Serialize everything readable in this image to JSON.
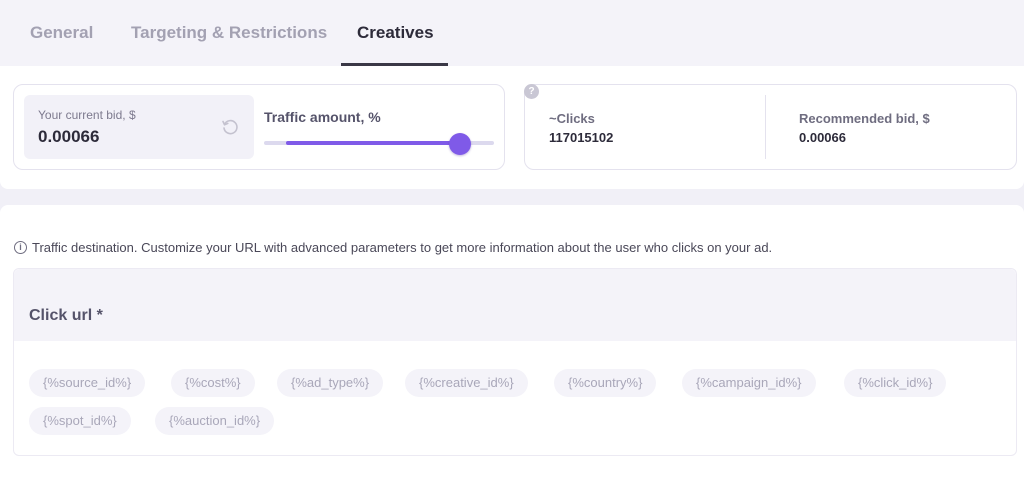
{
  "tabs": [
    {
      "label": "General"
    },
    {
      "label": "Targeting & Restrictions"
    },
    {
      "label": "Creatives"
    }
  ],
  "active_tab": "Creatives",
  "bid": {
    "label": "Your current bid, $",
    "value": "0.00066"
  },
  "traffic": {
    "label": "Traffic amount, %",
    "level_percent": 85
  },
  "stats": {
    "clicks_label": "~Clicks",
    "clicks_value": "117015102",
    "recommended_label": "Recommended bid, $",
    "recommended_value": "0.00066",
    "help_glyph": "?"
  },
  "destination": {
    "info_text": "Traffic destination. Customize your URL with advanced parameters to get more information about the user who clicks on your ad.",
    "info_glyph": "i",
    "click_url_placeholder": "Click url *",
    "params": [
      "{%source_id%}",
      "{%cost%}",
      "{%ad_type%}",
      "{%creative_id%}",
      "{%country%}",
      "{%campaign_id%}",
      "{%click_id%}",
      "{%spot_id%}",
      "{%auction_id%}"
    ]
  },
  "colors": {
    "accent": "#7f5ae8",
    "track": "#dcd9ee"
  },
  "icons": {
    "reset": "reset-icon",
    "help": "help-icon",
    "info": "info-icon"
  }
}
